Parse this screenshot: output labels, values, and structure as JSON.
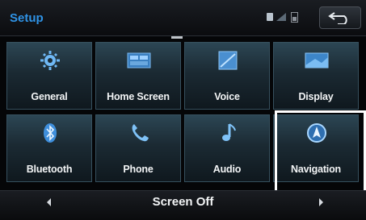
{
  "header": {
    "title": "Setup",
    "status_icons": [
      "bluetooth-icon",
      "signal-icon",
      "battery-icon"
    ],
    "back_icon": "back-arrow-icon"
  },
  "tiles": [
    {
      "label": "General",
      "icon": "gear-icon"
    },
    {
      "label": "Home Screen",
      "icon": "home-screen-icon"
    },
    {
      "label": "Voice",
      "icon": "voice-icon"
    },
    {
      "label": "Display",
      "icon": "display-icon"
    },
    {
      "label": "Bluetooth",
      "icon": "bluetooth-icon"
    },
    {
      "label": "Phone",
      "icon": "phone-icon"
    },
    {
      "label": "Audio",
      "icon": "music-note-icon"
    },
    {
      "label": "Navigation",
      "icon": "navigation-icon"
    }
  ],
  "bottom": {
    "screen_off_label": "Screen Off",
    "left_icon": "chevron-left-icon",
    "right_icon": "chevron-right-icon"
  },
  "colors": {
    "title_blue": "#2f93e6",
    "highlight": "#ffffff"
  }
}
